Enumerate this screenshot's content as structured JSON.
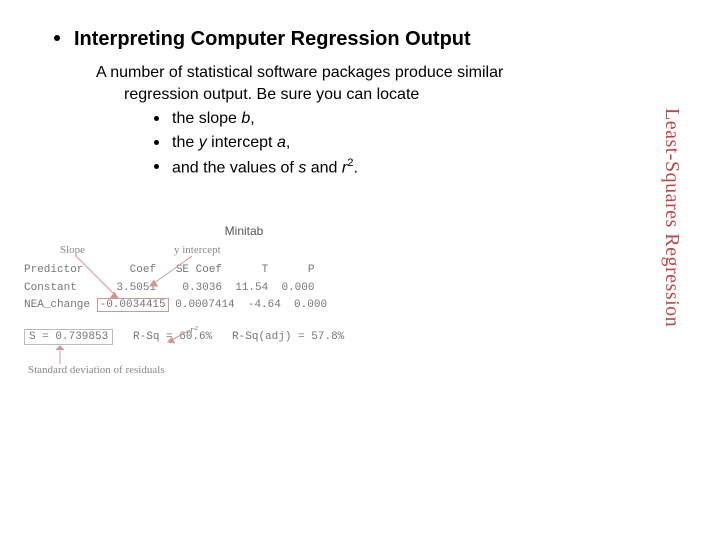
{
  "heading": "Interpreting Computer Regression Output",
  "para_line1": "A number of statistical software packages produce similar",
  "para_line2": "regression output. Be sure you can locate",
  "bullets": {
    "b1_pre": "the slope ",
    "b1_var": "b",
    "b1_post": ",",
    "b2_pre": "the ",
    "b2_var": "y",
    "b2_mid": " intercept ",
    "b2_var2": "a",
    "b2_post": ",",
    "b3_pre": "and the values of ",
    "b3_var": "s",
    "b3_mid": " and ",
    "b3_var2": "r",
    "b3_post": "."
  },
  "vlabel": "Least-Squares Regression",
  "fig": {
    "title": "Minitab",
    "annot_slope": "Slope",
    "annot_yint": "y intercept",
    "annot_r2": "r²",
    "annot_sdres": "Standard deviation of residuals",
    "header": "Predictor       Coef   SE Coef      T      P",
    "constant": "Constant      3.5051    0.3036  11.54  0.000",
    "nea_pre": "NEA_change ",
    "nea_coef": "-0.0034415",
    "nea_rest": " 0.0007414  -4.64  0.000",
    "s_pre": "S = 0.739853",
    "rsq": "   R-Sq = 60.6%",
    "rsqa": "   R-Sq(adj) = 57.8%"
  },
  "chart_data": {
    "type": "table",
    "title": "Minitab regression output",
    "columns": [
      "Predictor",
      "Coef",
      "SE Coef",
      "T",
      "P"
    ],
    "rows": [
      {
        "Predictor": "Constant",
        "Coef": 3.5051,
        "SE Coef": 0.3036,
        "T": 11.54,
        "P": 0.0
      },
      {
        "Predictor": "NEA_change",
        "Coef": -0.0034415,
        "SE Coef": 0.0007414,
        "T": -4.64,
        "P": 0.0
      }
    ],
    "summary": {
      "S": 0.739853,
      "R-Sq": "60.6%",
      "R-Sq(adj)": "57.8%"
    },
    "annotations": {
      "slope": -0.0034415,
      "y_intercept": 3.5051,
      "s": 0.739853,
      "r_squared": 0.606
    }
  }
}
